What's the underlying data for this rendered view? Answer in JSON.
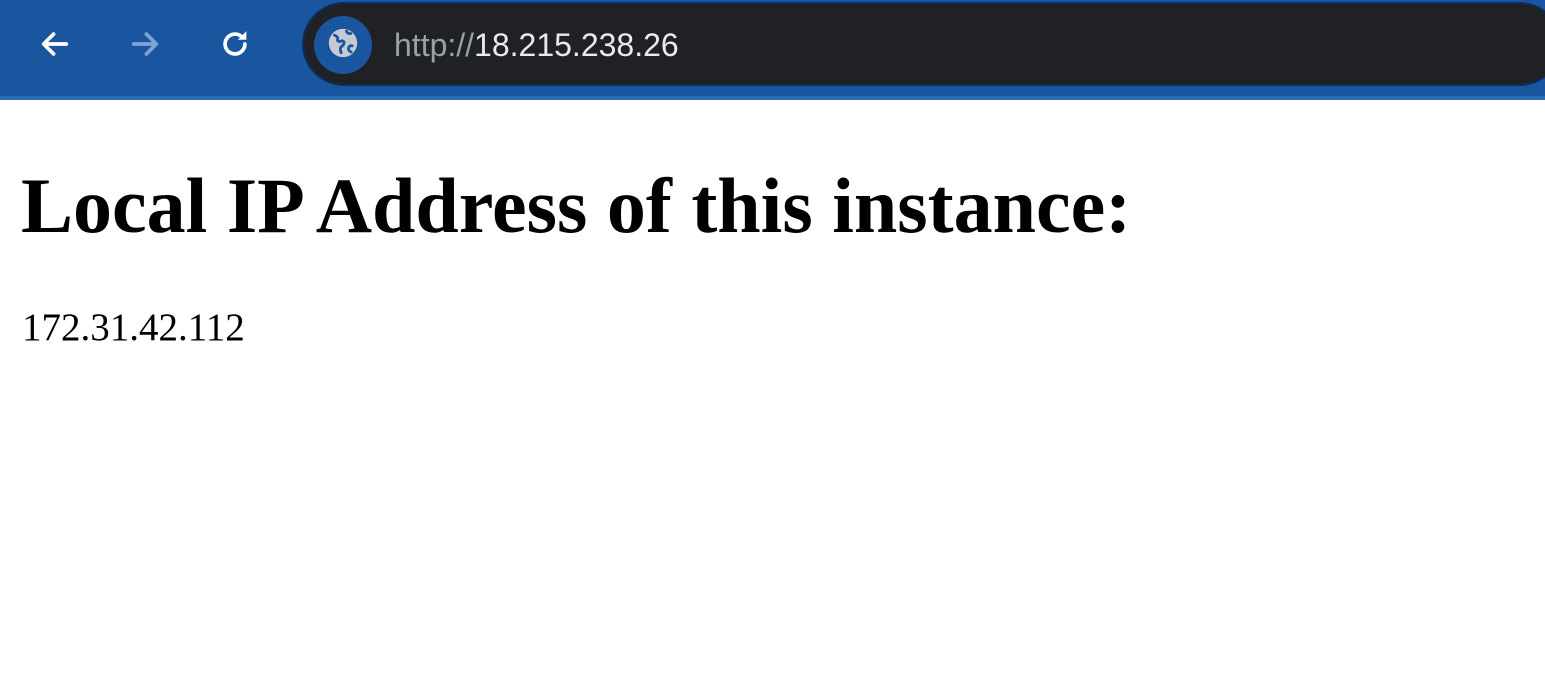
{
  "browser": {
    "toolbar_color": "#1a56a0",
    "omnibox_color": "#202124",
    "nav": {
      "back_icon": "arrow-left-icon",
      "forward_icon": "arrow-right-icon",
      "forward_enabled": false,
      "reload_icon": "reload-icon"
    },
    "address_bar": {
      "site_icon": "globe-icon",
      "scheme": "http://",
      "host": "18.215.238.26"
    }
  },
  "page": {
    "heading": "Local IP Address of this instance:",
    "ip_address": "172.31.42.112"
  }
}
